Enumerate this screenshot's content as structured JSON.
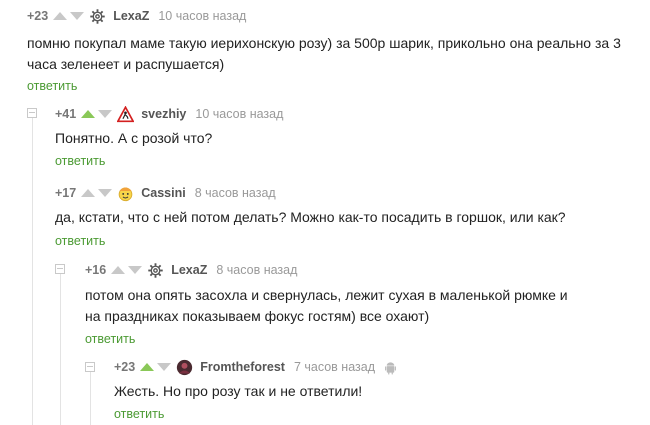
{
  "comments": [
    {
      "rating": "+23",
      "author": "LexaZ",
      "time": "10 часов назад",
      "avatar": "gear-icon",
      "upvoted": false,
      "text": "помню покупал маме такую иерихонскую розу) за 500р шарик, прикольно она реально за 3 часа зеленеет и распушается)",
      "reply": "ответить"
    },
    {
      "rating": "+41",
      "author": "svezhiy",
      "time": "10 часов назад",
      "avatar": "roadwork-sign-icon",
      "upvoted": true,
      "text": "Понятно. А с розой что?",
      "reply": "ответить"
    },
    {
      "rating": "+17",
      "author": "Cassini",
      "time": "8 часов назад",
      "avatar": "emoji-face-icon",
      "upvoted": false,
      "text": "да, кстати, что с ней потом делать? Можно как-то посадить в горшок, или как?",
      "reply": "ответить"
    },
    {
      "rating": "+16",
      "author": "LexaZ",
      "time": "8 часов назад",
      "avatar": "gear-icon",
      "upvoted": false,
      "text": "потом она опять засохла и свернулась, лежит сухая в маленькой рюмке и на праздниках показываем фокус гостям) все охают)",
      "reply": "ответить"
    },
    {
      "rating": "+23",
      "author": "Fromtheforest",
      "time": "7 часов назад",
      "avatar": "user-photo-icon",
      "upvoted": true,
      "platform_icon": "android-icon",
      "text": "Жесть. Но про розу так и не ответили!",
      "reply": "ответить"
    }
  ]
}
